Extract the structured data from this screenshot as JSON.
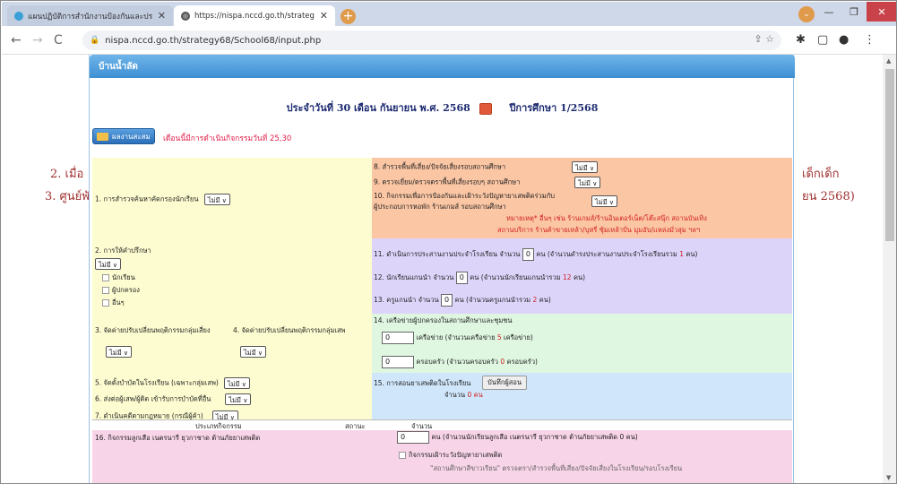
{
  "browser": {
    "tabs": [
      {
        "label": "แผนปฏิบัติการสำนักงานป้องกันและปราบ"
      },
      {
        "label": "https://nispa.nccd.go.th/strategy"
      }
    ],
    "url": "nispa.nccd.go.th/strategy68/School68/input.php"
  },
  "background_text": {
    "left1": "2. เมื่อ",
    "left2": "3. ศูนย์พั",
    "right1": "เด็กเด็ก",
    "right2": "ยน 2568)"
  },
  "dialog": {
    "title": "บ้านน้ำลัด",
    "date_text": "ประจำวันที่ 30 เดือน กันยายน พ.ศ. 2568",
    "year_text": "ปีการศึกษา 1/2568",
    "report_button": "ผลงานสะสม",
    "notice": "เดือนนี้มีการดำเนินกิจกรรมวันที่ 25,30"
  },
  "form": {
    "select_value": "ไม่มี",
    "q1": "1. การสำรวจค้นหาคัดกรองนักเรียน",
    "q8": "8. สำรวจพื้นที่เสี่ยง/ปัจจัยเสี่ยงรอบสถานศึกษา",
    "q9": "9. ตรวจเยี่ยม/ตรวจตราพื้นที่เสี่ยงรอบๆ สถานศึกษา",
    "q10a": "10. กิจกรรมเพื่อการป้องกันและเฝ้าระวังปัญหายาเสพติดร่วมกับ",
    "q10b": "ผู้ประกอบการหอพัก ร้านเกมส์ รอบสถานศึกษา",
    "q10note1": "หมายเหตุ* อื่นๆ เช่น ร้านเกมส์/ร้านอินเตอร์เน็ต/โต๊ะสนุ๊ก สถานบันเทิง",
    "q10note2": "สถานบริการ ร้านค้าขายเหล้า/บุหรี่ ซุ้มเหล้าปั่น มุมอับ/แหล่งมั่วสุม ฯลฯ",
    "q2": "2. การให้คำปรึกษา",
    "q2_opts": [
      "นักเรียน",
      "ผู้ปกครอง",
      "อื่นๆ"
    ],
    "q11a": "11. ดำเนินการประสานงานประจำโรงเรียน จำนวน",
    "q11b": "คน (จำนวนดำรงประสานงานประจำโรงเรียนรวม",
    "q11n": "1",
    "q11c": "คน)",
    "q11v": "0",
    "q12a": "12. นักเรียนแกนนำ จำนวน",
    "q12b": "คน (จำนวนนักเรียนแกนนำรวม",
    "q12n": "12",
    "q12c": "คน)",
    "q12v": "0",
    "q13a": "13. ครูแกนนำ จำนวน",
    "q13b": "คน (จำนวนครูแกนนำรวม",
    "q13n": "2",
    "q13c": "คน)",
    "q13v": "0",
    "q3": "3. จัดค่ายปรับเปลี่ยนพฤติกรรมกลุ่มเสี่ยง",
    "q4": "4. จัดค่ายปรับเปลี่ยนพฤติกรรมกลุ่มเสพ",
    "q14": "14. เครือข่ายผู้ปกครองในสถานศึกษาและชุมชน",
    "q14a": "เครือข่าย (จำนวนเครือข่าย",
    "q14an": "5",
    "q14ac": "เครือข่าย)",
    "q14b": "ครอบครัว (จำนวนครอบครัว",
    "q14bn": "0",
    "q14bc": "ครอบครัว)",
    "q14v": "0",
    "q5": "5. จัดตั้งบำบัดในโรงเรียน (เฉพาะกลุ่มเสพ)",
    "q6": "6. ส่งต่อผู้เสพ/ผู้ติด เข้ารับการบำบัดที่อื่น",
    "q7": "7. ดำเนินคดีตามกฎหมาย (กรณีผู้ค้า)",
    "q15": "15. การสอนยาเสพติดในโรงเรียน",
    "q15btn": "บันทึกผู้สอน",
    "q15sub": "จำนวน",
    "q15n": "0",
    "q15c": "คน",
    "tbl_h1": "ประเภทกิจกรรม",
    "tbl_h2": "สถานะ",
    "tbl_h3": "จำนวน",
    "q16": "16. กิจกรรมลูกเสือ เนตรนารี ยุวกาชาด ต้านภัยยาเสพติด",
    "q16v": "0",
    "q16b": "คน (จำนวนนักเรียนลูกเสือ เนตรนารี ยุวกาชาด ต้านภัยยาเสพติด 0 คน)",
    "q16c": "กิจกรรมเฝ้าระวังปัญหายาเสพติด",
    "q16d": "\"สถานศึกษาสีขาวเรียน\" ตรวจตรา/สำรวจพื้นที่เสี่ยง/ปัจจัยเสี่ยงในโรงเรียน/รอบโรงเรียน"
  }
}
